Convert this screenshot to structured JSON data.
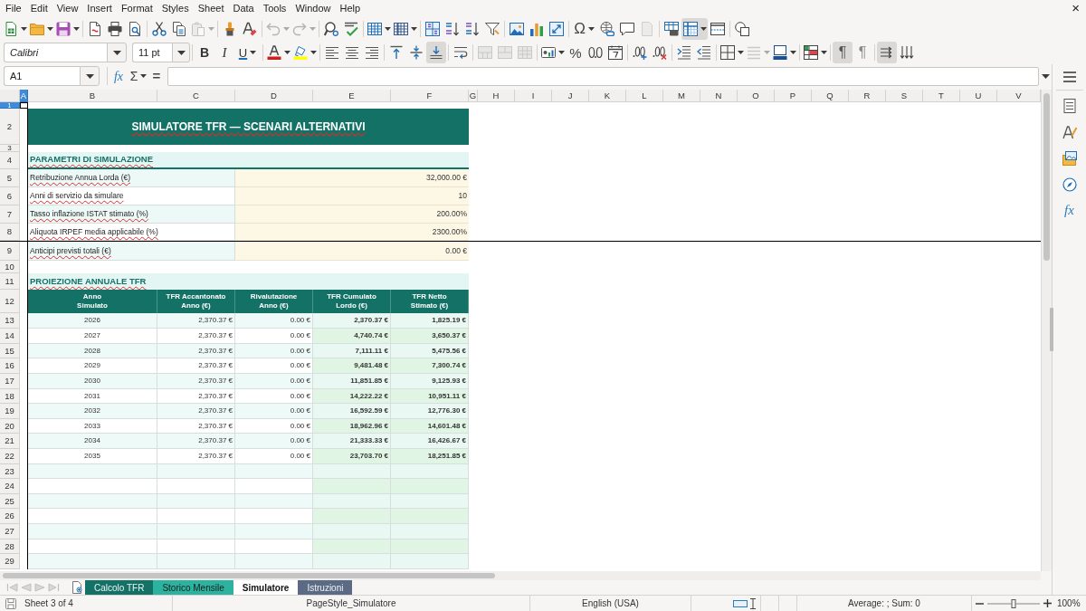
{
  "menu_bar": {
    "items": [
      "File",
      "Edit",
      "View",
      "Insert",
      "Format",
      "Styles",
      "Sheet",
      "Data",
      "Tools",
      "Window",
      "Help"
    ],
    "close": "×"
  },
  "standard_toolbar": [
    {
      "on": false,
      "disabled": false
    },
    {
      "on": false,
      "disabled": false
    },
    {
      "on": false,
      "disabled": false
    },
    {
      "on": false,
      "disabled": false
    },
    {
      "on": false,
      "disabled": false
    },
    {
      "on": false,
      "disabled": false
    },
    {
      "on": false,
      "disabled": false
    },
    {
      "on": false,
      "disabled": false
    },
    {
      "on": false,
      "disabled": true
    },
    {
      "on": false,
      "disabled": false
    },
    {
      "on": false,
      "disabled": false
    },
    {
      "on": false,
      "disabled": true
    },
    {
      "on": false,
      "disabled": true
    },
    {
      "on": false,
      "disabled": false
    },
    {
      "on": false,
      "disabled": false
    },
    {
      "on": false,
      "disabled": false
    },
    {
      "on": false,
      "disabled": false
    },
    {
      "on": false,
      "disabled": false
    },
    {
      "on": false,
      "disabled": false
    },
    {
      "on": false,
      "disabled": false
    },
    {
      "on": false,
      "disabled": false
    },
    {
      "on": false,
      "disabled": false
    },
    {
      "on": false,
      "disabled": false
    },
    {
      "on": false,
      "disabled": false
    },
    {
      "glyph": "Ω",
      "on": false,
      "disabled": false
    },
    {
      "on": false,
      "disabled": false
    },
    {
      "on": false,
      "disabled": false
    },
    {
      "on": false,
      "disabled": true
    },
    {
      "on": false,
      "disabled": false
    },
    {
      "on": true,
      "disabled": false
    },
    {
      "on": false,
      "disabled": false
    },
    {
      "on": false,
      "disabled": false
    }
  ],
  "formatting_toolbar": {
    "font_name": "Calibri",
    "font_size": "11 pt",
    "buttons": [
      {
        "glyph": "B",
        "on": false,
        "disabled": false
      },
      {
        "glyph": "I",
        "on": false,
        "disabled": false
      },
      {
        "glyph": "U",
        "on": false,
        "disabled": false
      },
      {
        "on": false,
        "disabled": false
      },
      {
        "on": false,
        "disabled": false
      },
      {
        "on": false,
        "disabled": false
      },
      {
        "on": false,
        "disabled": false
      },
      {
        "on": false,
        "disabled": false
      },
      {
        "on": false,
        "disabled": false
      },
      {
        "on": false,
        "disabled": false
      },
      {
        "on": true,
        "disabled": false
      },
      {
        "on": false,
        "disabled": false
      },
      {
        "on": false,
        "disabled": true
      },
      {
        "on": false,
        "disabled": true
      },
      {
        "on": false,
        "disabled": true
      },
      {
        "on": false,
        "disabled": false
      },
      {
        "glyph": "%",
        "on": false,
        "disabled": false
      },
      {
        "on": false,
        "disabled": false
      },
      {
        "on": false,
        "disabled": false
      },
      {
        "on": false,
        "disabled": false
      },
      {
        "on": false,
        "disabled": false
      },
      {
        "on": false,
        "disabled": false
      },
      {
        "on": false,
        "disabled": false
      },
      {
        "on": false,
        "disabled": false
      },
      {
        "on": false,
        "disabled": true
      },
      {
        "on": false,
        "disabled": false
      },
      {
        "on": false,
        "disabled": false
      },
      {
        "glyph": "¶",
        "on": true,
        "disabled": false
      },
      {
        "glyph": "¶",
        "on": false,
        "disabled": false
      },
      {
        "on": true,
        "disabled": false
      },
      {
        "on": false,
        "disabled": false
      }
    ]
  },
  "formula_bar": {
    "name_box": "A1",
    "function_wizard": "fx",
    "sum": "Σ",
    "equals": "="
  },
  "sidebar": {
    "functions": "fx"
  },
  "sheet": {
    "spelling_marks": true,
    "columns": [
      {
        "label": "A",
        "selected": true
      },
      {
        "label": "B",
        "selected": false
      },
      {
        "label": "C",
        "selected": false
      },
      {
        "label": "D",
        "selected": false
      },
      {
        "label": "E",
        "selected": false
      },
      {
        "label": "F",
        "selected": false
      },
      {
        "label": "G",
        "selected": false
      },
      {
        "label": "H",
        "selected": false
      },
      {
        "label": "I",
        "selected": false
      },
      {
        "label": "J",
        "selected": false
      },
      {
        "label": "K",
        "selected": false
      },
      {
        "label": "L",
        "selected": false
      },
      {
        "label": "M",
        "selected": false
      },
      {
        "label": "N",
        "selected": false
      },
      {
        "label": "O",
        "selected": false
      },
      {
        "label": "P",
        "selected": false
      },
      {
        "label": "Q",
        "selected": false
      },
      {
        "label": "R",
        "selected": false
      },
      {
        "label": "S",
        "selected": false
      },
      {
        "label": "T",
        "selected": false
      },
      {
        "label": "U",
        "selected": false
      },
      {
        "label": "V",
        "selected": false
      }
    ],
    "rows": [
      {
        "label": "1",
        "selected": true
      },
      {
        "label": "2",
        "selected": false
      },
      {
        "label": "3",
        "selected": false
      },
      {
        "label": "4",
        "selected": false
      },
      {
        "label": "5",
        "selected": false
      },
      {
        "label": "6",
        "selected": false
      },
      {
        "label": "7",
        "selected": false
      },
      {
        "label": "8",
        "selected": false
      },
      {
        "label": "9",
        "selected": false
      },
      {
        "label": "10",
        "selected": false
      },
      {
        "label": "11",
        "selected": false
      },
      {
        "label": "12",
        "selected": false
      },
      {
        "label": "13",
        "selected": false
      },
      {
        "label": "14",
        "selected": false
      },
      {
        "label": "15",
        "selected": false
      },
      {
        "label": "16",
        "selected": false
      },
      {
        "label": "17",
        "selected": false
      },
      {
        "label": "18",
        "selected": false
      },
      {
        "label": "19",
        "selected": false
      },
      {
        "label": "20",
        "selected": false
      },
      {
        "label": "21",
        "selected": false
      },
      {
        "label": "22",
        "selected": false
      },
      {
        "label": "23",
        "selected": false
      },
      {
        "label": "24",
        "selected": false
      },
      {
        "label": "25",
        "selected": false
      },
      {
        "label": "26",
        "selected": false
      },
      {
        "label": "27",
        "selected": false
      },
      {
        "label": "28",
        "selected": false
      },
      {
        "label": "29",
        "selected": false
      }
    ],
    "title": "SIMULATORE TFR — SCENARI ALTERNATIVI",
    "parameters": {
      "heading": "PARAMETRI DI SIMULAZIONE",
      "items": [
        {
          "label": "Retribuzione Annua Lorda (€)",
          "value": "32,000.00 €"
        },
        {
          "label": "Anni di servizio da simulare",
          "value": "10"
        },
        {
          "label": "Tasso inflazione ISTAT stimato (%)",
          "value": "200.00%"
        },
        {
          "label": "Aliquota IRPEF media applicabile (%)",
          "value": "2300.00%"
        },
        {
          "label": "Anticipi previsti totali (€)",
          "value": "0.00 €"
        }
      ]
    },
    "projection": {
      "heading": "PROIEZIONE ANNUALE TFR",
      "columns": [
        "Anno\nSimulato",
        "TFR Accantonato\nAnno (€)",
        "Rivalutazione\nAnno (€)",
        "TFR Cumulato\nLordo (€)",
        "TFR Netto\nStimato (€)"
      ],
      "rows": [
        [
          "2026",
          "2,370.37 €",
          "0.00 €",
          "2,370.37 €",
          "1,825.19 €"
        ],
        [
          "2027",
          "2,370.37 €",
          "0.00 €",
          "4,740.74 €",
          "3,650.37 €"
        ],
        [
          "2028",
          "2,370.37 €",
          "0.00 €",
          "7,111.11 €",
          "5,475.56 €"
        ],
        [
          "2029",
          "2,370.37 €",
          "0.00 €",
          "9,481.48 €",
          "7,300.74 €"
        ],
        [
          "2030",
          "2,370.37 €",
          "0.00 €",
          "11,851.85 €",
          "9,125.93 €"
        ],
        [
          "2031",
          "2,370.37 €",
          "0.00 €",
          "14,222.22 €",
          "10,951.11 €"
        ],
        [
          "2032",
          "2,370.37 €",
          "0.00 €",
          "16,592.59 €",
          "12,776.30 €"
        ],
        [
          "2033",
          "2,370.37 €",
          "0.00 €",
          "18,962.96 €",
          "14,601.48 €"
        ],
        [
          "2034",
          "2,370.37 €",
          "0.00 €",
          "21,333.33 €",
          "16,426.67 €"
        ],
        [
          "2035",
          "2,370.37 €",
          "0.00 €",
          "23,703.70 €",
          "18,251.85 €"
        ]
      ]
    }
  },
  "sheet_navigation": [
    {
      "disabled": true
    },
    {
      "disabled": true
    },
    {
      "disabled": true
    },
    {
      "disabled": true
    }
  ],
  "sheet_tabs": [
    {
      "label": "Calcolo TFR",
      "selected": false,
      "color": "#137265"
    },
    {
      "label": "Storico Mensile",
      "selected": false,
      "color": "#2bb39f"
    },
    {
      "label": "Simulatore",
      "selected": true
    },
    {
      "label": "Istruzioni",
      "selected": false,
      "color": "#5b6b86"
    }
  ],
  "status_bar": {
    "sheet_position": "Sheet 3 of 4",
    "page_style": "PageStyle_Simulatore",
    "language": "English (USA)",
    "selection_summary": "Average: ; Sum: 0",
    "zoom": {
      "level": 0.5,
      "percent": "100%"
    }
  }
}
